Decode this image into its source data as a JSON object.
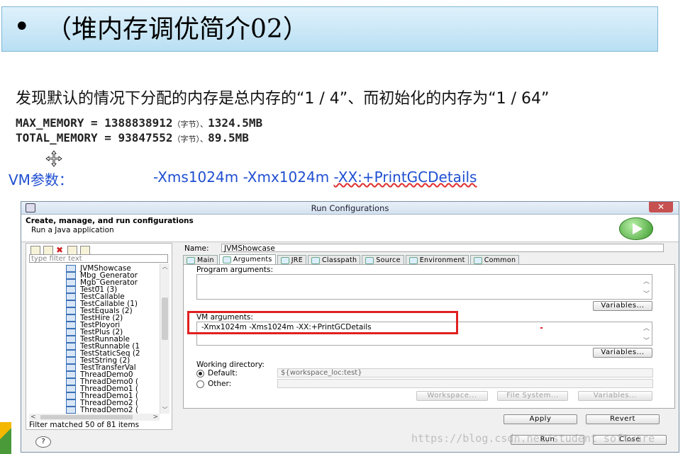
{
  "slide": {
    "bullet": "•",
    "title": "（堆内存调优简介02）",
    "note": "发现默认的情况下分配的内存是总内存的“1 / 4”、而初始化的内存为“1 / 64”",
    "max_memory_left": "MAX_MEMORY = 1388838912",
    "max_memory_unit": "（字节）、",
    "max_memory_right": "1324.5MB",
    "total_memory_left": "TOTAL_MEMORY = 93847552",
    "total_memory_unit": "（字节）、",
    "total_memory_right": "89.5MB",
    "vm_label": "VM参数：",
    "vm_value_plain": "-Xms1024m -Xmx1024m ",
    "vm_value_squiggle": "-XX:+PrintGCDetails",
    "text_color": "#1f4fd1"
  },
  "dialog": {
    "title": "Run Configurations",
    "close_glyph": "✕",
    "header_title": "Create, manage, and run configurations",
    "header_subtitle": "Run a Java application",
    "filter_placeholder": "type filter text",
    "tree_items": [
      "JVMShowcase",
      "Mbg_Generator",
      "Mgb_Generator",
      "Test01 (3)",
      "TestCallable",
      "TestCallable (1)",
      "TestEquals (2)",
      "TestHire (2)",
      "TestPloyori",
      "TestPlus (2)",
      "TestRunnable",
      "TestRunnable (1",
      "TestStaticSeq (2",
      "TestString (2)",
      "TestTransferVal",
      "ThreadDemo0",
      "ThreadDemo0 (",
      "ThreadDemo1 (",
      "ThreadDemo1 (",
      "ThreadDemo2 (",
      "ThreadDemo2 ("
    ],
    "filter_status": "Filter matched 50 of 81 items",
    "name_label": "Name:",
    "name_value": "JVMShowcase",
    "tabs": [
      "Main",
      "Arguments",
      "JRE",
      "Classpath",
      "Source",
      "Environment",
      "Common"
    ],
    "active_tab": "Arguments",
    "program_arguments_label": "Program arguments:",
    "program_arguments_value": "",
    "vm_arguments_label": "VM arguments:",
    "vm_arguments_value": "-Xmx1024m -Xms1024m -XX:+PrintGCDetails",
    "variables_button": "Variables...",
    "working_directory_label": "Working directory:",
    "default_label": "Default:",
    "default_value": "${workspace_loc:test}",
    "other_label": "Other:",
    "workspace_button": "Workspace...",
    "filesystem_button": "File System...",
    "apply_button": "Apply",
    "revert_button": "Revert",
    "run_button": "Run",
    "close_button": "Close",
    "help_glyph": "?"
  },
  "watermark": "https://blog.csdn.net/student_software",
  "colors": {
    "banner": "#c8e7f7",
    "accent_red": "#e02020",
    "link_blue": "#1f4fd1"
  }
}
